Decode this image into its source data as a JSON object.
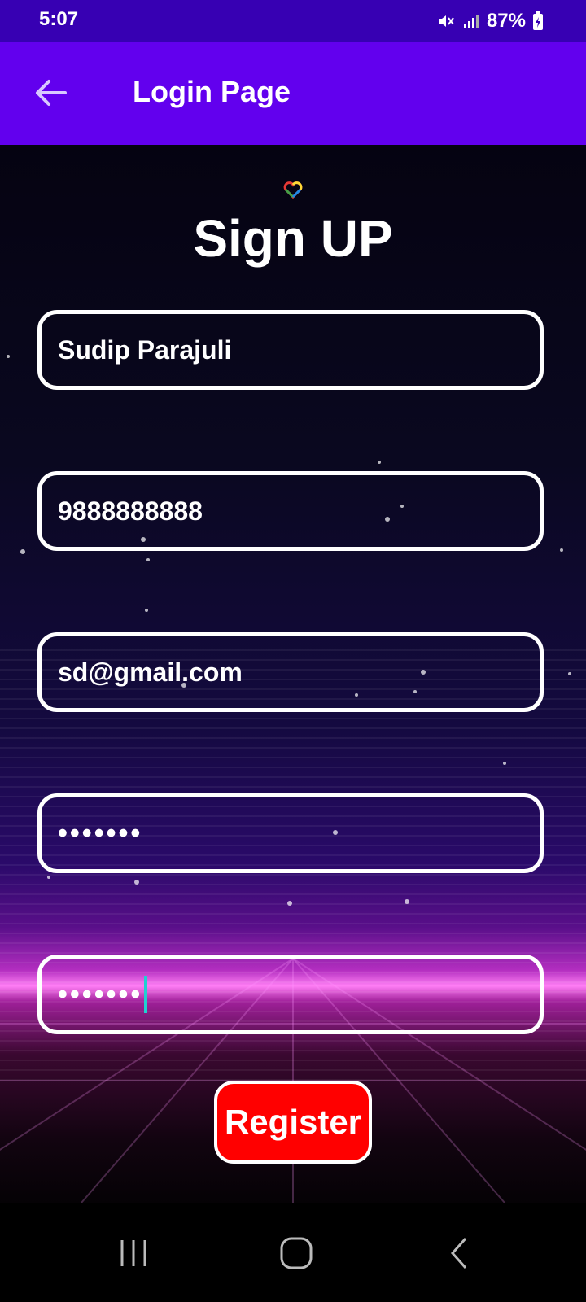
{
  "status_bar": {
    "time": "5:07",
    "battery_percent": "87%",
    "icons": [
      "mute-icon",
      "signal-icon",
      "battery-charging-icon"
    ]
  },
  "app_bar": {
    "title": "Login Page",
    "back_icon": "arrow-left-icon"
  },
  "form": {
    "heading": "Sign UP",
    "fields": [
      {
        "name": "name",
        "value": "Sudip Parajuli"
      },
      {
        "name": "phone",
        "value": "9888888888"
      },
      {
        "name": "email",
        "value": "sd@gmail.com"
      },
      {
        "name": "password",
        "value": "•••••••"
      },
      {
        "name": "confirm_password",
        "value": "•••••••"
      }
    ],
    "register_label": "Register"
  },
  "colors": {
    "status_bar": "#3700B3",
    "app_bar": "#6200EE",
    "register_button": "#FF0000",
    "caret": "#20D0D0"
  },
  "nav_bar": {
    "icons": [
      "recent-apps-icon",
      "home-icon",
      "back-icon"
    ]
  }
}
